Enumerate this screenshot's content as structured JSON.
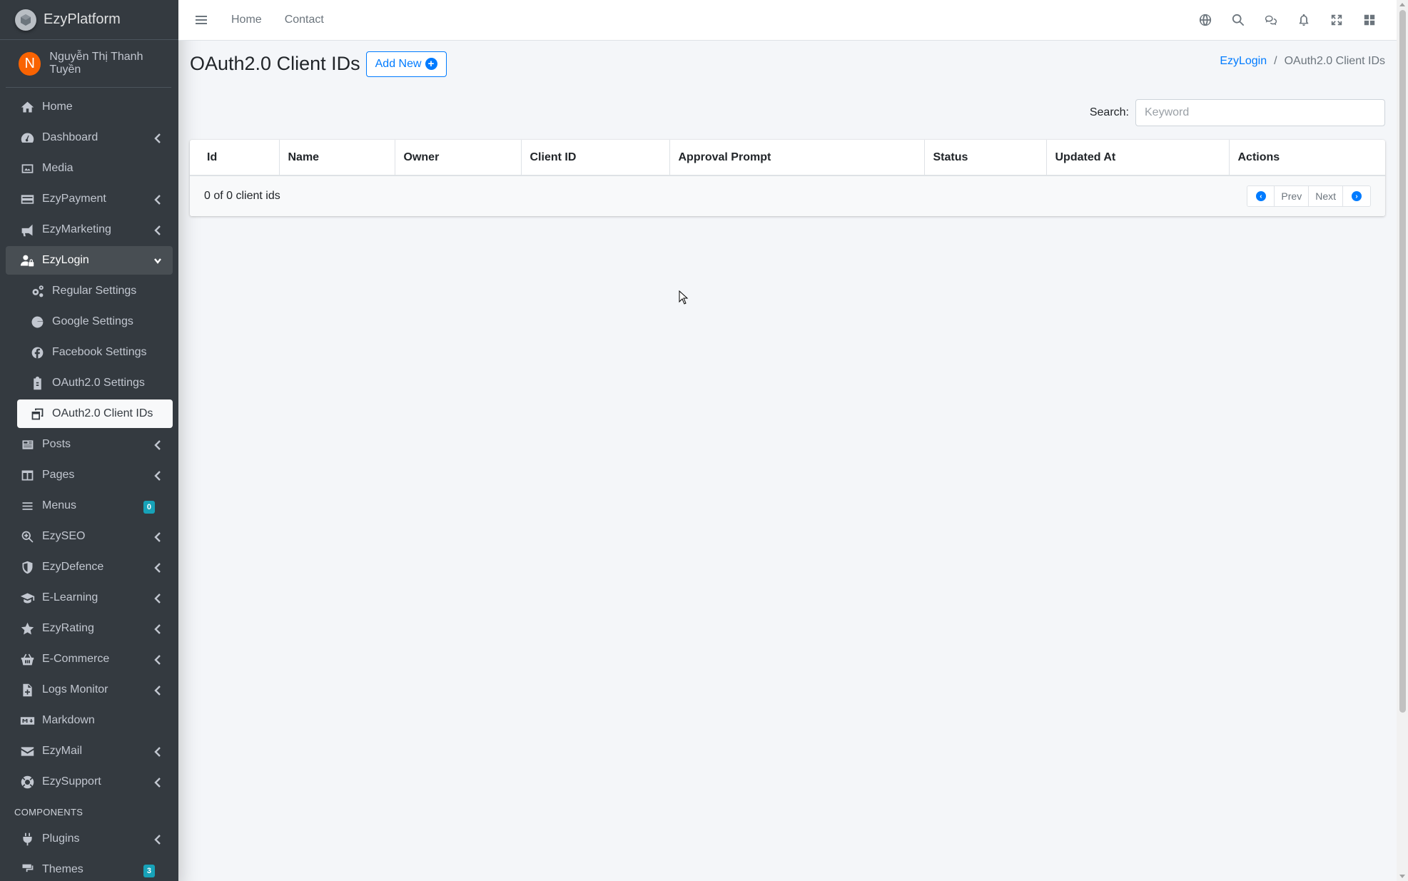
{
  "brand": {
    "name": "EzyPlatform"
  },
  "user": {
    "initial": "N",
    "name": "Nguyễn Thị Thanh Tuyền"
  },
  "sidebar": {
    "items": [
      {
        "label": "Home",
        "icon": "home-icon"
      },
      {
        "label": "Dashboard",
        "icon": "dashboard-icon"
      },
      {
        "label": "Media",
        "icon": "image-icon"
      },
      {
        "label": "EzyPayment",
        "icon": "credit-card-icon"
      },
      {
        "label": "EzyMarketing",
        "icon": "bullhorn-icon"
      },
      {
        "label": "EzyLogin",
        "icon": "user-lock-icon"
      },
      {
        "label": "Regular Settings",
        "icon": "cogs-icon"
      },
      {
        "label": "Google Settings",
        "icon": "google-icon"
      },
      {
        "label": "Facebook Settings",
        "icon": "facebook-icon"
      },
      {
        "label": "OAuth2.0 Settings",
        "icon": "clipboard-icon"
      },
      {
        "label": "OAuth2.0 Client IDs",
        "icon": "window-restore-icon"
      },
      {
        "label": "Posts",
        "icon": "newspaper-icon"
      },
      {
        "label": "Pages",
        "icon": "columns-icon"
      },
      {
        "label": "Menus",
        "icon": "bars-icon",
        "badge": "0"
      },
      {
        "label": "EzySEO",
        "icon": "search-plus-icon"
      },
      {
        "label": "EzyDefence",
        "icon": "shield-icon"
      },
      {
        "label": "E-Learning",
        "icon": "graduation-cap-icon"
      },
      {
        "label": "EzyRating",
        "icon": "star-icon"
      },
      {
        "label": "E-Commerce",
        "icon": "basket-icon"
      },
      {
        "label": "Logs Monitor",
        "icon": "file-medical-icon"
      },
      {
        "label": "Markdown",
        "icon": "markdown-icon"
      },
      {
        "label": "EzyMail",
        "icon": "envelope-icon"
      },
      {
        "label": "EzySupport",
        "icon": "life-ring-icon"
      }
    ],
    "section_header": "COMPONENTS",
    "components": [
      {
        "label": "Plugins",
        "icon": "plug-icon"
      },
      {
        "label": "Themes",
        "icon": "paint-icon",
        "badge": "3"
      }
    ]
  },
  "topbar": {
    "links": [
      "Home",
      "Contact"
    ],
    "icons": [
      "globe-icon",
      "search-icon",
      "comments-icon",
      "bell-icon",
      "expand-icon",
      "grid-icon"
    ]
  },
  "page": {
    "title": "OAuth2.0 Client IDs",
    "add_button": "Add New",
    "breadcrumb": {
      "parent": "EzyLogin",
      "current": "OAuth2.0 Client IDs"
    }
  },
  "search": {
    "label": "Search:",
    "placeholder": "Keyword",
    "value": ""
  },
  "table": {
    "columns": [
      "Id",
      "Name",
      "Owner",
      "Client ID",
      "Approval Prompt",
      "Status",
      "Updated At",
      "Actions"
    ],
    "rows": [],
    "footer_count": "0 of 0 client ids",
    "pagination": {
      "prev": "Prev",
      "next": "Next"
    }
  },
  "colors": {
    "sidebar_bg": "#343a40",
    "accent": "#007bff",
    "avatar": "#f96302",
    "badge": "#17a2b8"
  }
}
